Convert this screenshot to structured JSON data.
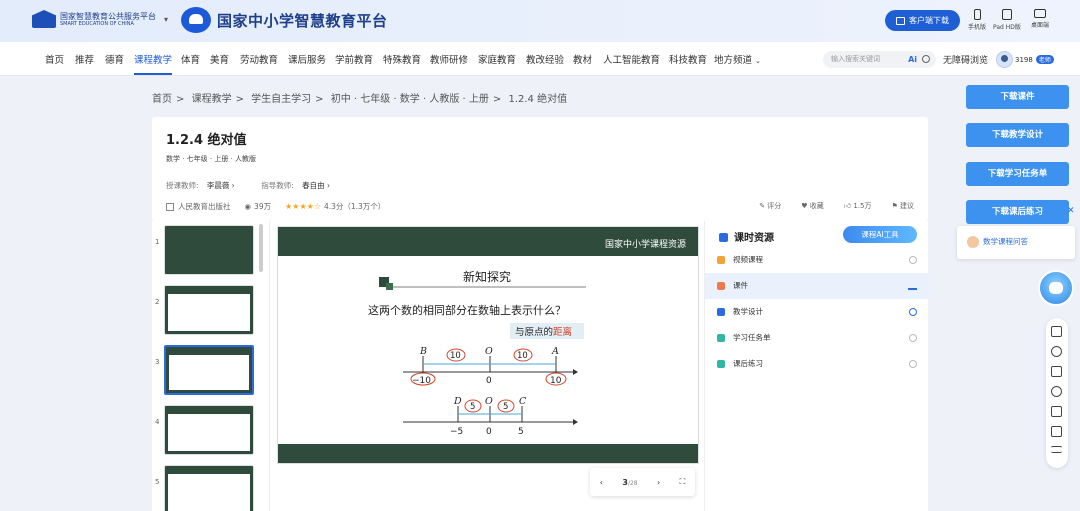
{
  "header": {
    "org_name": "国家智慧教育公共服务平台",
    "org_name_en": "SMART EDUCATION OF CHINA",
    "platform_title": "国家中小学智慧教育平台",
    "client_download": "客户端下载",
    "devices": [
      "手机版",
      "Pad HD版",
      "桌面端"
    ]
  },
  "nav": {
    "items": [
      "首页",
      "推荐",
      "德育",
      "课程教学",
      "体育",
      "美育",
      "劳动教育",
      "课后服务",
      "学前教育",
      "特殊教育",
      "教师研修",
      "家庭教育",
      "教改经验",
      "教材",
      "人工智能教育",
      "科技教育",
      "地方频道"
    ],
    "active_index": 3,
    "search_placeholder": "输入搜索关键词",
    "ai_label": "Ai",
    "barrier_free": "无障碍浏览",
    "user_points": "3198",
    "user_badge": "老师"
  },
  "breadcrumb": [
    "首页",
    "课程教学",
    "学生自主学习",
    "初中 · 七年级 · 数学 · 人教版 · 上册",
    "1.2.4 绝对值"
  ],
  "lesson": {
    "title": "1.2.4 绝对值",
    "subtitle": "数学 · 七年级 · 上册 · 人教版",
    "teacher_label": "授课教师:",
    "teacher_name": "李晨薇 ›",
    "guide_label": "指导教师:",
    "guide_name": "春自由 ›",
    "publisher": "人民教育出版社",
    "views": "39万",
    "stars": "★★★★☆",
    "rating": "4.3分（1.3万个）",
    "actions": [
      "评分",
      "收藏",
      "1.5万",
      "建议"
    ]
  },
  "thumbnails": [
    "1",
    "2",
    "3",
    "4",
    "5"
  ],
  "slide": {
    "header_text": "国家中小学课程资源",
    "heading": "新知探究",
    "question": "这两个数的相同部分在数轴上表示什么？",
    "callout_prefix": "与原点的",
    "callout_highlight": "距离",
    "line1_letters": [
      "B",
      "O",
      "A"
    ],
    "line1_circled": [
      "10",
      "10"
    ],
    "line1_ticks": [
      "−10",
      "0",
      "10"
    ],
    "line2_letters": [
      "D",
      "O",
      "C"
    ],
    "line2_circled": [
      "5",
      "5"
    ],
    "line2_ticks": [
      "−5",
      "0",
      "5"
    ]
  },
  "pager": {
    "current": "3",
    "total": "/28"
  },
  "resources": {
    "title": "课时资源",
    "ai_tool": "课程AI工具",
    "items": [
      "视频课程",
      "课件",
      "教学设计",
      "学习任务单",
      "课后练习"
    ],
    "selected_index": 1
  },
  "side_buttons": [
    "下载课件",
    "下载教学设计",
    "下载学习任务单",
    "下载课后练习"
  ],
  "assistant_popup": "数学课程问答"
}
